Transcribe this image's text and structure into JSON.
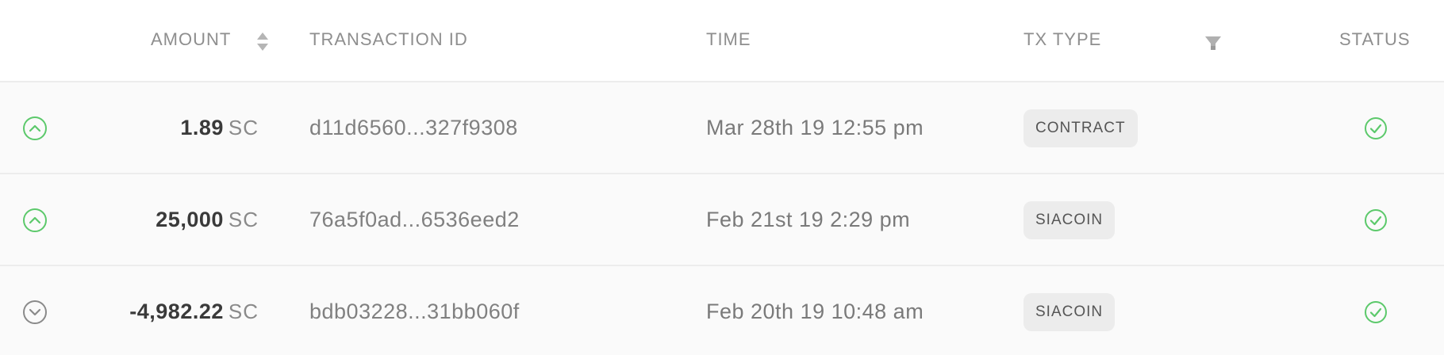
{
  "columns": {
    "amount": "AMOUNT",
    "transaction_id": "TRANSACTION ID",
    "time": "TIME",
    "tx_type": "TX TYPE",
    "status": "STATUS"
  },
  "rows": [
    {
      "direction": "incoming",
      "direction_icon": "chevron-up-circle-icon",
      "amount": "1.89",
      "unit": "SC",
      "transaction_id": "d11d6560...327f9308",
      "time": "Mar 28th 19 12:55 pm",
      "tx_type": "CONTRACT",
      "status_icon": "check-circle-icon"
    },
    {
      "direction": "incoming",
      "direction_icon": "chevron-up-circle-icon",
      "amount": "25,000",
      "unit": "SC",
      "transaction_id": "76a5f0ad...6536eed2",
      "time": "Feb 21st 19 2:29 pm",
      "tx_type": "SIACOIN",
      "status_icon": "check-circle-icon"
    },
    {
      "direction": "outgoing",
      "direction_icon": "chevron-down-circle-icon",
      "amount": "-4,982.22",
      "unit": "SC",
      "transaction_id": "bdb03228...31bb060f",
      "time": "Feb 20th 19 10:48 am",
      "tx_type": "SIACOIN",
      "status_icon": "check-circle-icon"
    }
  ],
  "colors": {
    "incoming": "#5cc96b",
    "outgoing": "#8a8a8a",
    "success": "#5cc96b",
    "header_text": "#8e8e8e",
    "badge_bg": "#ececec"
  }
}
